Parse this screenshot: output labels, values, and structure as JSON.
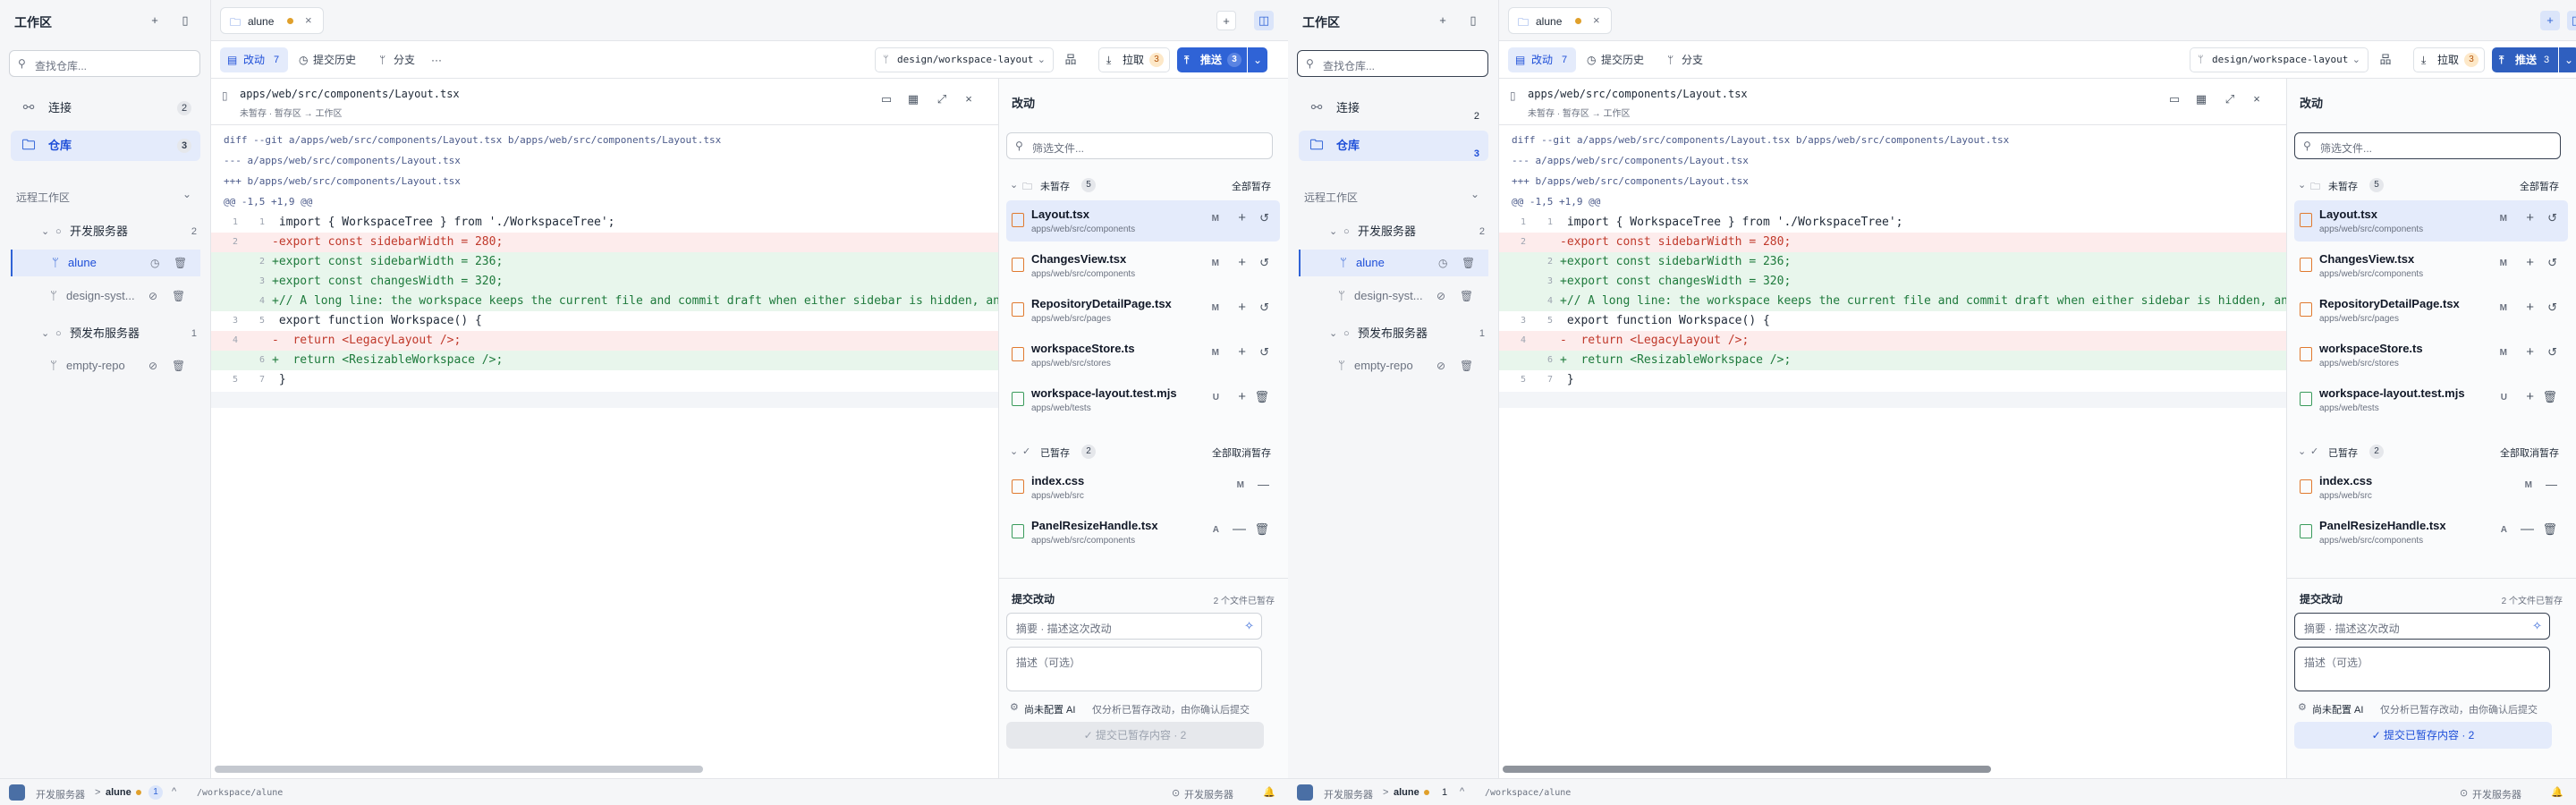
{
  "sidebar": {
    "title": "工作区",
    "search_placeholder": "查找仓库...",
    "nav": [
      {
        "label": "连接",
        "count": "2",
        "icon": "connection-icon"
      },
      {
        "label": "仓库",
        "count": "3",
        "icon": "folder-icon"
      }
    ],
    "remote_section": "远程工作区",
    "servers": [
      {
        "name": "开发服务器",
        "count": "2",
        "repos": [
          "alune",
          "design-syst..."
        ]
      },
      {
        "name": "预发布服务器",
        "count": "1",
        "repos": [
          "empty-repo"
        ]
      }
    ]
  },
  "tab": {
    "label": "alune",
    "close": "×"
  },
  "toolbar": {
    "tabs": [
      {
        "label": "改动",
        "count": "7"
      },
      {
        "label": "提交历史"
      },
      {
        "label": "分支"
      }
    ],
    "more": "···",
    "branch": "design/workspace-layout",
    "pull_label": "拉取",
    "pull_count": "3",
    "push_label": "推送",
    "push_count": "3"
  },
  "diff": {
    "file_path": "apps/web/src/components/Layout.tsx",
    "breadcrumb": "未暂存 · 暂存区 → 工作区",
    "header_lines": [
      "diff --git a/apps/web/src/components/Layout.tsx b/apps/web/src/components/Layout.tsx",
      "--- a/apps/web/src/components/Layout.tsx",
      "+++ b/apps/web/src/components/Layout.tsx",
      "@@ -1,5 +1,9 @@"
    ],
    "lines": [
      {
        "old": "1",
        "new": "1",
        "type": "ctx",
        "text": " import { WorkspaceTree } from './WorkspaceTree';"
      },
      {
        "old": "2",
        "new": "",
        "type": "del",
        "text": "-export const sidebarWidth = 280;"
      },
      {
        "old": "",
        "new": "2",
        "type": "add",
        "text": "+export const sidebarWidth = 236;"
      },
      {
        "old": "",
        "new": "3",
        "type": "add",
        "text": "+export const changesWidth = 320;"
      },
      {
        "old": "",
        "new": "4",
        "type": "add",
        "text": "+// A long line: the workspace keeps the current file and commit draft when either sidebar is hidden, and"
      },
      {
        "old": "3",
        "new": "5",
        "type": "ctx",
        "text": " export function Workspace() {"
      },
      {
        "old": "4",
        "new": "",
        "type": "del",
        "text": "-  return <LegacyLayout />;"
      },
      {
        "old": "",
        "new": "6",
        "type": "add",
        "text": "+  return <ResizableWorkspace />;"
      },
      {
        "old": "5",
        "new": "7",
        "type": "ctx",
        "text": " }"
      }
    ]
  },
  "changes": {
    "title": "改动",
    "filter_placeholder": "筛选文件...",
    "unstaged_label": "未暂存",
    "unstaged_count": "5",
    "stage_all": "全部暂存",
    "unstaged": [
      {
        "name": "Layout.tsx",
        "path": "apps/web/src/components",
        "status": "M"
      },
      {
        "name": "ChangesView.tsx",
        "path": "apps/web/src/components",
        "status": "M"
      },
      {
        "name": "RepositoryDetailPage.tsx",
        "path": "apps/web/src/pages",
        "status": "M"
      },
      {
        "name": "workspaceStore.ts",
        "path": "apps/web/src/stores",
        "status": "M"
      },
      {
        "name": "workspace-layout.test.mjs",
        "path": "apps/web/tests",
        "status": "U"
      }
    ],
    "staged_label": "已暂存",
    "staged_count": "2",
    "unstage_all": "全部取消暂存",
    "staged": [
      {
        "name": "index.css",
        "path": "apps/web/src",
        "status": "M"
      },
      {
        "name": "PanelResizeHandle.tsx",
        "path": "apps/web/src/components",
        "status": "A"
      }
    ]
  },
  "commit": {
    "title": "提交改动",
    "staged_info": "2 个文件已暂存",
    "summary_placeholder": "摘要 · 描述这次改动",
    "desc_placeholder": "描述（可选）",
    "ai_label": "尚未配置 AI",
    "ai_hint": "仅分析已暂存改动，由你确认后提交",
    "button": "✓ 提交已暂存内容 · 2"
  },
  "status": {
    "server": "开发服务器",
    "sep": ">",
    "repo": "alune",
    "count": "1",
    "path": "/workspace/alune",
    "right_server": "开发服务器"
  },
  "colors": {
    "accent": "#2f63d6",
    "add_bg": "#e8f6ec",
    "del_bg": "#fdecec",
    "selected_bg": "#e4ebfb"
  }
}
